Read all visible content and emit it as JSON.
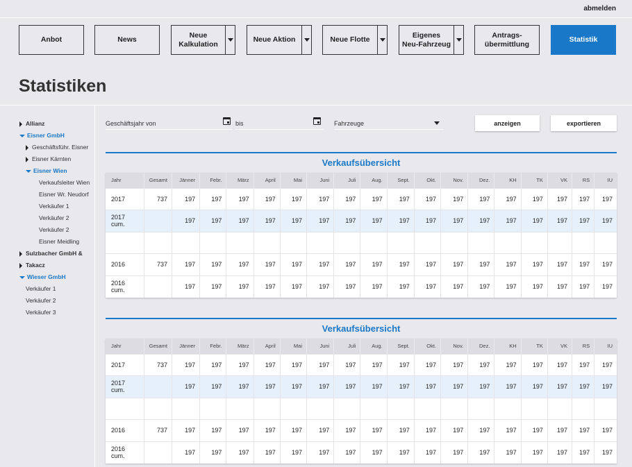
{
  "header": {
    "logout": "abmelden"
  },
  "nav": [
    {
      "label": "Anbot",
      "dropdown": false
    },
    {
      "label": "News",
      "dropdown": false
    },
    {
      "label": "Neue\nKalkulation",
      "dropdown": true
    },
    {
      "label": "Neue Aktion",
      "dropdown": true
    },
    {
      "label": "Neue Flotte",
      "dropdown": true
    },
    {
      "label": "Eigenes\nNeu-Fahrzeug",
      "dropdown": true
    },
    {
      "label": "Antrags-\nübermittlung",
      "dropdown": false
    },
    {
      "label": "Statistik",
      "dropdown": false,
      "active": true
    }
  ],
  "page": {
    "title": "Statistiken"
  },
  "tree": [
    {
      "label": "Allianz",
      "level": 0,
      "state": "collapsed",
      "bold": true,
      "blue": false
    },
    {
      "label": "Eisner GmbH",
      "level": 0,
      "state": "expanded",
      "bold": true,
      "blue": true
    },
    {
      "label": "Geschäftsführ. Eisner",
      "level": 1,
      "state": "collapsed",
      "bold": false,
      "blue": false
    },
    {
      "label": "Eisner Kärnten",
      "level": 1,
      "state": "collapsed",
      "bold": false,
      "blue": false
    },
    {
      "label": "Eisner Wien",
      "level": 1,
      "state": "expanded",
      "bold": true,
      "blue": true
    },
    {
      "label": "Verkaufsleiter Wien",
      "level": 2,
      "state": "leaf",
      "bold": false,
      "blue": false
    },
    {
      "label": "Eisner Wr. Neudorf",
      "level": 2,
      "state": "leaf",
      "bold": false,
      "blue": false
    },
    {
      "label": "Verkäufer 1",
      "level": 2,
      "state": "leaf",
      "bold": false,
      "blue": false
    },
    {
      "label": "Verkäufer 2",
      "level": 2,
      "state": "leaf",
      "bold": false,
      "blue": false
    },
    {
      "label": "Verkäufer 2",
      "level": 2,
      "state": "leaf",
      "bold": false,
      "blue": false
    },
    {
      "label": "Eisner Meidling",
      "level": 2,
      "state": "leaf",
      "bold": false,
      "blue": false
    },
    {
      "label": "Sulzbacher GmbH &",
      "level": 0,
      "state": "collapsed",
      "bold": true,
      "blue": false
    },
    {
      "label": "Takacz",
      "level": 0,
      "state": "collapsed",
      "bold": true,
      "blue": false
    },
    {
      "label": "Wieser GmbH",
      "level": 0,
      "state": "expanded",
      "bold": true,
      "blue": true
    },
    {
      "label": "Verkäufer 1",
      "level": 1,
      "state": "leaf",
      "bold": false,
      "blue": false
    },
    {
      "label": "Verkäufer 2",
      "level": 1,
      "state": "leaf",
      "bold": false,
      "blue": false
    },
    {
      "label": "Verkäufer 3",
      "level": 1,
      "state": "leaf",
      "bold": false,
      "blue": false
    }
  ],
  "filters": {
    "from_label": "Geschäftsjahr von",
    "to_label": "bis",
    "type_value": "Fahrzeuge",
    "show_button": "anzeigen",
    "export_button": "exportieren"
  },
  "tables": [
    {
      "title": "Verkaufsübersicht",
      "columns": [
        "Jahr",
        "Gesamt",
        "Jänner",
        "Febr.",
        "März",
        "April",
        "Mai",
        "Juni",
        "Juli",
        "Aug.",
        "Sept.",
        "Okt.",
        "Nov.",
        "Dez.",
        "KH",
        "TK",
        "VK",
        "RS",
        "IU"
      ],
      "rows": [
        {
          "cells": [
            "2017",
            "737",
            "197",
            "197",
            "197",
            "197",
            "197",
            "197",
            "197",
            "197",
            "197",
            "197",
            "197",
            "197",
            "197",
            "197",
            "197",
            "197",
            "197"
          ],
          "cum": false
        },
        {
          "cells": [
            "2017 cum.",
            "",
            "197",
            "197",
            "197",
            "197",
            "197",
            "197",
            "197",
            "197",
            "197",
            "197",
            "197",
            "197",
            "197",
            "197",
            "197",
            "197",
            "197"
          ],
          "cum": true
        },
        {
          "cells": [
            "",
            "",
            "",
            "",
            "",
            "",
            "",
            "",
            "",
            "",
            "",
            "",
            "",
            "",
            "",
            "",
            "",
            "",
            ""
          ],
          "cum": false
        },
        {
          "cells": [
            "2016",
            "737",
            "197",
            "197",
            "197",
            "197",
            "197",
            "197",
            "197",
            "197",
            "197",
            "197",
            "197",
            "197",
            "197",
            "197",
            "197",
            "197",
            "197"
          ],
          "cum": false
        },
        {
          "cells": [
            "2016 cum.",
            "",
            "197",
            "197",
            "197",
            "197",
            "197",
            "197",
            "197",
            "197",
            "197",
            "197",
            "197",
            "197",
            "197",
            "197",
            "197",
            "197",
            "197"
          ],
          "cum": false
        }
      ]
    },
    {
      "title": "Verkaufsübersicht",
      "columns": [
        "Jahr",
        "Gesamt",
        "Jänner",
        "Febr.",
        "März",
        "April",
        "Mai",
        "Juni",
        "Juli",
        "Aug.",
        "Sept.",
        "Okt.",
        "Nov.",
        "Dez.",
        "KH",
        "TK",
        "VK",
        "RS",
        "IU"
      ],
      "rows": [
        {
          "cells": [
            "2017",
            "737",
            "197",
            "197",
            "197",
            "197",
            "197",
            "197",
            "197",
            "197",
            "197",
            "197",
            "197",
            "197",
            "197",
            "197",
            "197",
            "197",
            "197"
          ],
          "cum": false
        },
        {
          "cells": [
            "2017 cum.",
            "",
            "197",
            "197",
            "197",
            "197",
            "197",
            "197",
            "197",
            "197",
            "197",
            "197",
            "197",
            "197",
            "197",
            "197",
            "197",
            "197",
            "197"
          ],
          "cum": true
        },
        {
          "cells": [
            "",
            "",
            "",
            "",
            "",
            "",
            "",
            "",
            "",
            "",
            "",
            "",
            "",
            "",
            "",
            "",
            "",
            "",
            ""
          ],
          "cum": false
        },
        {
          "cells": [
            "2016",
            "737",
            "197",
            "197",
            "197",
            "197",
            "197",
            "197",
            "197",
            "197",
            "197",
            "197",
            "197",
            "197",
            "197",
            "197",
            "197",
            "197",
            "197"
          ],
          "cum": false
        },
        {
          "cells": [
            "2016 cum.",
            "",
            "197",
            "197",
            "197",
            "197",
            "197",
            "197",
            "197",
            "197",
            "197",
            "197",
            "197",
            "197",
            "197",
            "197",
            "197",
            "197",
            "197"
          ],
          "cum": false
        }
      ]
    }
  ],
  "colors": {
    "accent": "#1a78c8",
    "background": "#e8e8ed",
    "header_row": "#dcdce2",
    "cum_row": "#e6f0fa"
  }
}
